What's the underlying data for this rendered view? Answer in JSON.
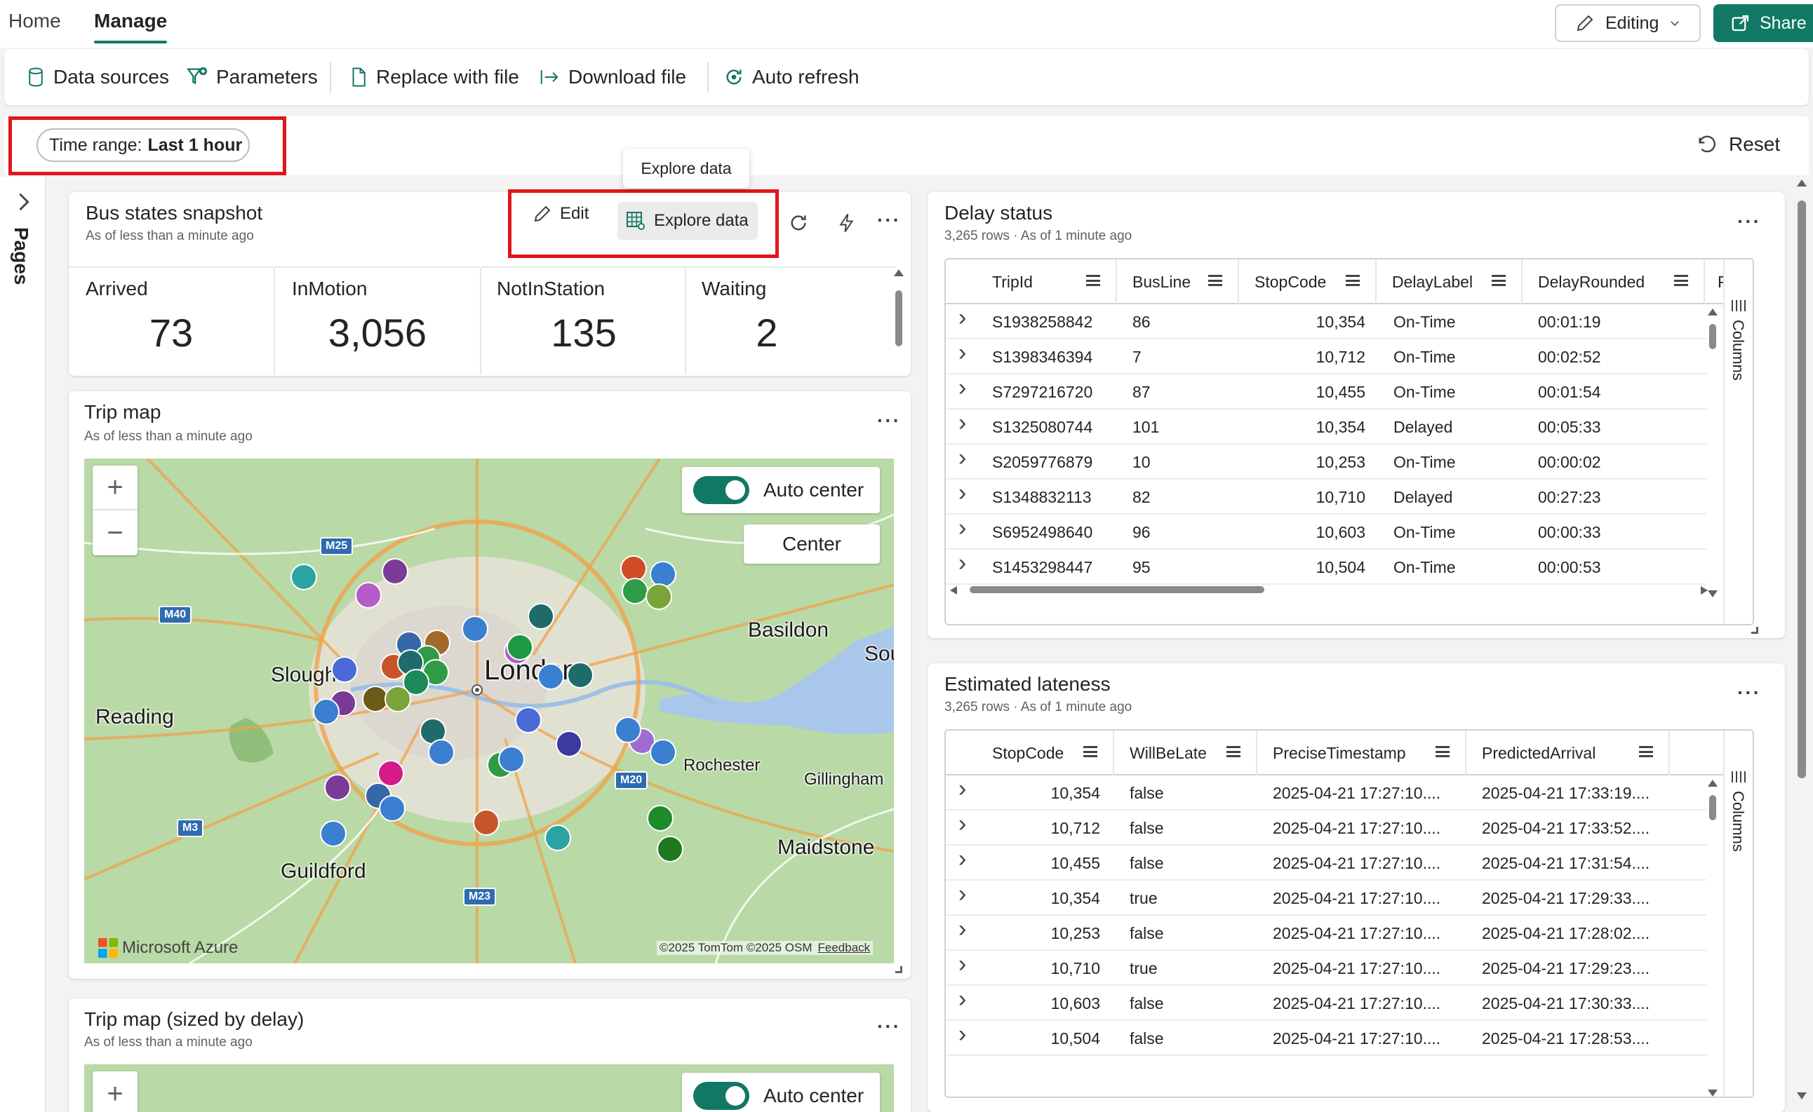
{
  "nav": {
    "home": "Home",
    "manage": "Manage",
    "editing": "Editing",
    "share": "Share"
  },
  "ribbon": {
    "data_sources": "Data sources",
    "parameters": "Parameters",
    "replace_with_file": "Replace with file",
    "download_file": "Download file",
    "auto_refresh": "Auto refresh"
  },
  "filter": {
    "prefix": "Time range:",
    "value": "Last 1 hour",
    "reset": "Reset"
  },
  "sidebar": {
    "pages": "Pages"
  },
  "bus_states": {
    "title": "Bus states snapshot",
    "subtitle": "As of less than a minute ago",
    "edit": "Edit",
    "explore": "Explore data",
    "tooltip": "Explore data",
    "stats": [
      {
        "label": "Arrived",
        "value": "73"
      },
      {
        "label": "InMotion",
        "value": "3,056"
      },
      {
        "label": "NotInStation",
        "value": "135"
      },
      {
        "label": "Waiting",
        "value": "2"
      }
    ]
  },
  "trip_map": {
    "title": "Trip map",
    "subtitle": "As of less than a minute ago",
    "auto_center": "Auto center",
    "center": "Center",
    "cities": {
      "london": "London",
      "slough": "Slough",
      "reading": "Reading",
      "guildford": "Guildford",
      "basildon": "Basildon",
      "southend": "Sou",
      "rochester": "Rochester",
      "gillingham": "Gillingham",
      "maidstone": "Maidstone"
    },
    "roads": {
      "m25": "M25",
      "m40": "M40",
      "m3": "M3",
      "m20": "M20",
      "m23": "M23"
    },
    "brand": "Microsoft Azure",
    "credits": "©2025 TomTom  ©2025 OSM",
    "feedback": "Feedback"
  },
  "trip_map_sized": {
    "title": "Trip map (sized by delay)",
    "subtitle": "As of less than a minute ago",
    "auto_center": "Auto center"
  },
  "delay_status": {
    "title": "Delay status",
    "subtitle": "3,265 rows · As of 1 minute ago",
    "columns_label": "Columns",
    "columns": [
      "TripId",
      "BusLine",
      "StopCode",
      "DelayLabel",
      "DelayRounded",
      "P"
    ],
    "rows": [
      [
        "S1938258842",
        "86",
        "10,354",
        "On-Time",
        "00:01:19"
      ],
      [
        "S1398346394",
        "7",
        "10,712",
        "On-Time",
        "00:02:52"
      ],
      [
        "S7297216720",
        "87",
        "10,455",
        "On-Time",
        "00:01:54"
      ],
      [
        "S1325080744",
        "101",
        "10,354",
        "Delayed",
        "00:05:33"
      ],
      [
        "S2059776879",
        "10",
        "10,253",
        "On-Time",
        "00:00:02"
      ],
      [
        "S1348832113",
        "82",
        "10,710",
        "Delayed",
        "00:27:23"
      ],
      [
        "S6952498640",
        "96",
        "10,603",
        "On-Time",
        "00:00:33"
      ],
      [
        "S1453298447",
        "95",
        "10,504",
        "On-Time",
        "00:00:53"
      ]
    ]
  },
  "estimated_lateness": {
    "title": "Estimated lateness",
    "subtitle": "3,265 rows · As of 1 minute ago",
    "columns_label": "Columns",
    "columns": [
      "StopCode",
      "WillBeLate",
      "PreciseTimestamp",
      "PredictedArrival"
    ],
    "rows": [
      [
        "10,354",
        "false",
        "2025-04-21 17:27:10....",
        "2025-04-21 17:33:19...."
      ],
      [
        "10,712",
        "false",
        "2025-04-21 17:27:10....",
        "2025-04-21 17:33:52...."
      ],
      [
        "10,455",
        "false",
        "2025-04-21 17:27:10....",
        "2025-04-21 17:31:54...."
      ],
      [
        "10,354",
        "true",
        "2025-04-21 17:27:10....",
        "2025-04-21 17:29:33...."
      ],
      [
        "10,253",
        "false",
        "2025-04-21 17:27:10....",
        "2025-04-21 17:28:02...."
      ],
      [
        "10,710",
        "true",
        "2025-04-21 17:27:10....",
        "2025-04-21 17:29:23...."
      ],
      [
        "10,603",
        "false",
        "2025-04-21 17:27:10....",
        "2025-04-21 17:30:33...."
      ],
      [
        "10,504",
        "false",
        "2025-04-21 17:27:10....",
        "2025-04-21 17:28:53...."
      ]
    ]
  },
  "colors": {
    "accent": "#117865",
    "highlight": "#e0161c"
  }
}
